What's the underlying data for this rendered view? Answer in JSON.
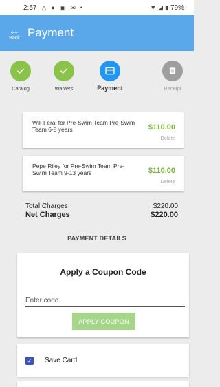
{
  "status_bar": {
    "time": "2:57",
    "battery": "79%"
  },
  "header": {
    "back_label": "Back",
    "title": "Payment",
    "color": "#5aa8ea"
  },
  "steps": [
    {
      "label": "Catalog",
      "state": "done",
      "icon": "check-icon"
    },
    {
      "label": "Waivers",
      "state": "done",
      "icon": "check-icon"
    },
    {
      "label": "Payment",
      "state": "active",
      "icon": "credit-card-icon"
    },
    {
      "label": "Receipt",
      "state": "todo",
      "icon": "receipt-icon"
    }
  ],
  "items": [
    {
      "description": "Will Feral for Pre-Swim Team Pre-Swim Team 6-8 years",
      "price": "$110.00",
      "delete_label": "Delete"
    },
    {
      "description": "Pepe Riley for Pre-Swim Team Pre-Swim Team 9-13 years",
      "price": "$110.00",
      "delete_label": "Delete"
    }
  ],
  "totals": {
    "total_label": "Total Charges",
    "total_value": "$220.00",
    "net_label": "Net Charges",
    "net_value": "$220.00"
  },
  "payment_details_title": "PAYMENT DETAILS",
  "coupon": {
    "title": "Apply a Coupon Code",
    "placeholder": "Enter code",
    "button_label": "APPLY COUPON"
  },
  "save_card": {
    "label": "Save Card",
    "checked": true
  },
  "colors": {
    "done": "#8bc34a",
    "active": "#2196f3",
    "todo": "#9e9e9e",
    "price": "#7cb342",
    "checkbox": "#3f51b5"
  }
}
